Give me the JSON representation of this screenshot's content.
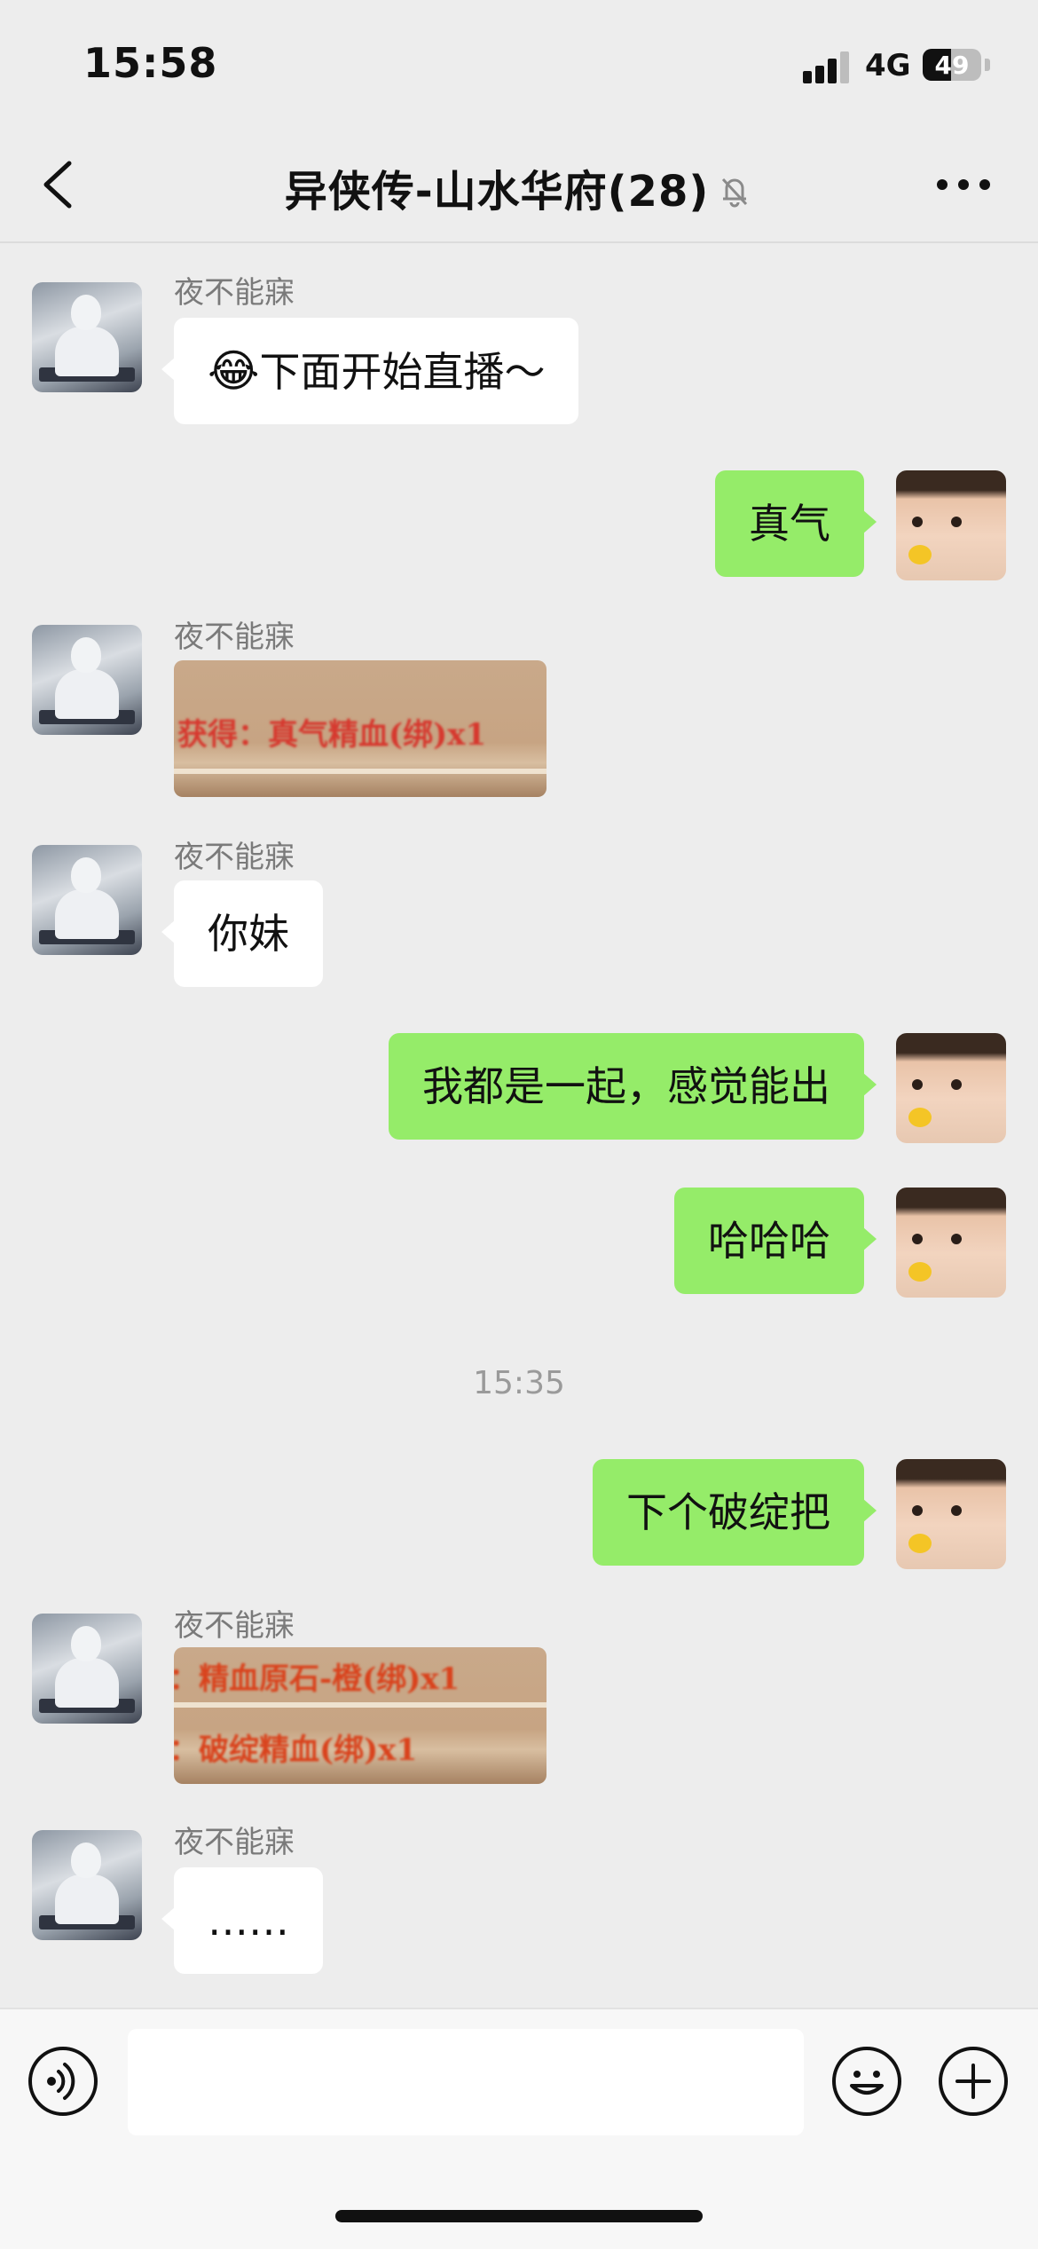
{
  "status_bar": {
    "time": "15:58",
    "network": "4G",
    "battery": "49",
    "battery_level": 0.49
  },
  "header": {
    "title": "异侠传-山水华府(28)",
    "muted": true
  },
  "messages": [
    {
      "side": "in",
      "sender": "夜不能寐",
      "emoji": "😂",
      "text": "下面开始直播～"
    },
    {
      "side": "out",
      "text": "真气"
    },
    {
      "side": "in",
      "sender": "夜不能寐",
      "image_text": [
        "获得：真气精血(绑)x1"
      ]
    },
    {
      "side": "in",
      "sender": "夜不能寐",
      "text": "你妹"
    },
    {
      "side": "out",
      "text": "我都是一起，感觉能出"
    },
    {
      "side": "out",
      "text": "哈哈哈"
    },
    {
      "timestamp": "15:35"
    },
    {
      "side": "out",
      "text": "下个破绽把"
    },
    {
      "side": "in",
      "sender": "夜不能寐",
      "image_text": [
        "：精血原石-橙(绑)x1",
        "：破绽精血(绑)x1"
      ]
    },
    {
      "side": "in",
      "sender": "夜不能寐",
      "text": "……"
    }
  ],
  "input": {
    "value": ""
  },
  "icons": {
    "voice": "voice-icon",
    "emoji": "emoji-icon",
    "plus": "plus-icon",
    "back": "back-icon",
    "more": "more-icon",
    "mute": "mute-bell-icon"
  },
  "colors": {
    "background": "#ededed",
    "outgoing_bubble": "#95ec69",
    "incoming_bubble": "#ffffff"
  }
}
